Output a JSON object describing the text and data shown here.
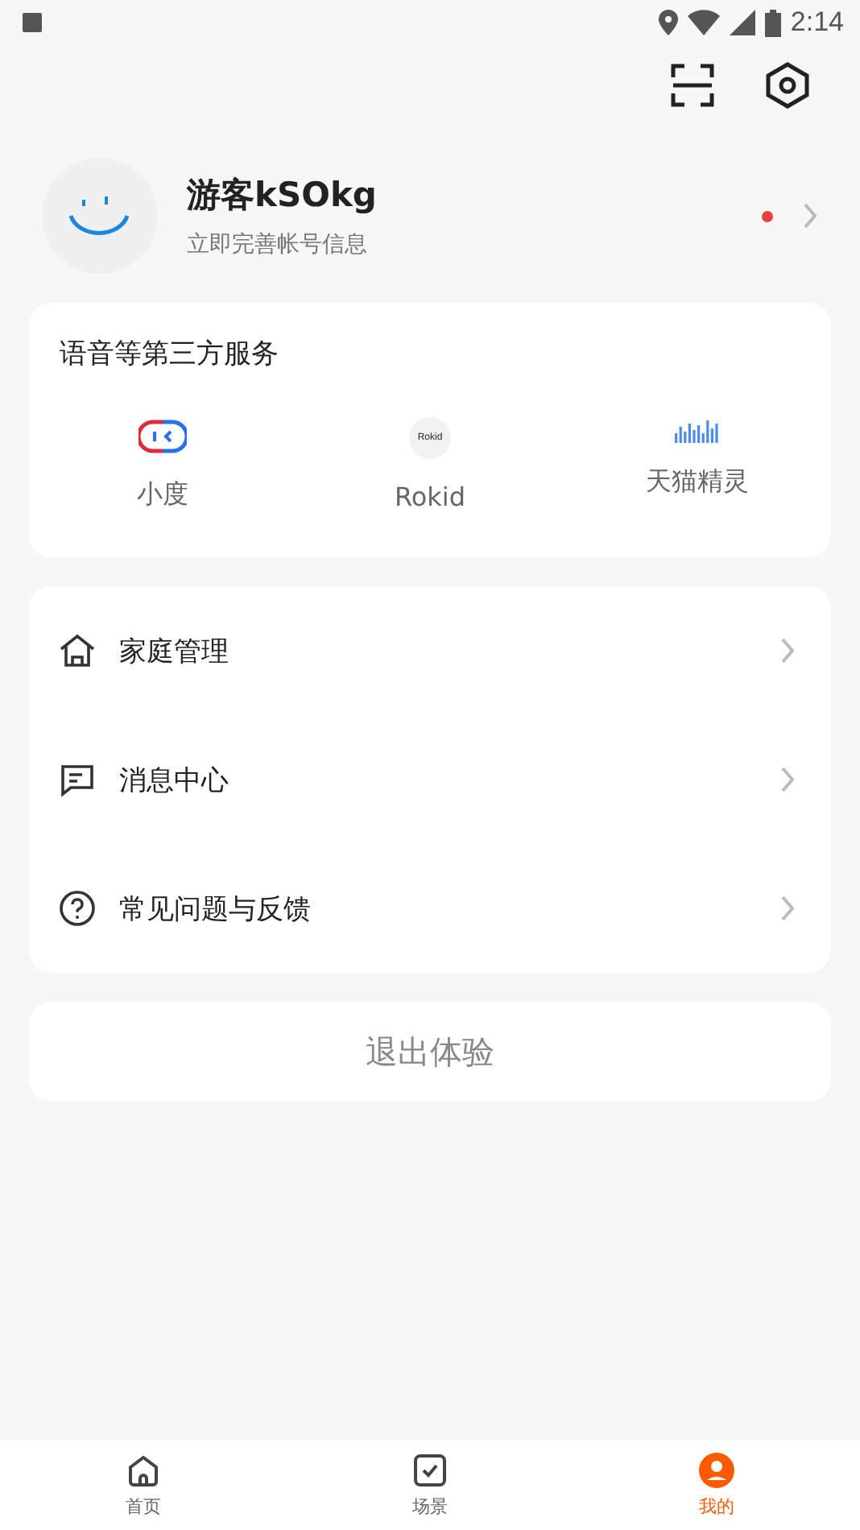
{
  "status_bar": {
    "time": "2:14"
  },
  "profile": {
    "name": "游客kSOkg",
    "subtitle": "立即完善帐号信息",
    "has_notice": true
  },
  "services": {
    "title": "语音等第三方服务",
    "items": [
      {
        "kind": "xiaodu",
        "label": "小度"
      },
      {
        "kind": "rokid",
        "label": "Rokid",
        "logo_text": "Rokid"
      },
      {
        "kind": "tmall",
        "label": "天猫精灵"
      }
    ]
  },
  "menu": [
    {
      "kind": "home",
      "label": "家庭管理"
    },
    {
      "kind": "message",
      "label": "消息中心"
    },
    {
      "kind": "help",
      "label": "常见问题与反馈"
    }
  ],
  "logout": {
    "label": "退出体验"
  },
  "tabs": [
    {
      "kind": "home",
      "label": "首页",
      "selected": false
    },
    {
      "kind": "scene",
      "label": "场景",
      "selected": false
    },
    {
      "kind": "me",
      "label": "我的",
      "selected": true
    }
  ]
}
